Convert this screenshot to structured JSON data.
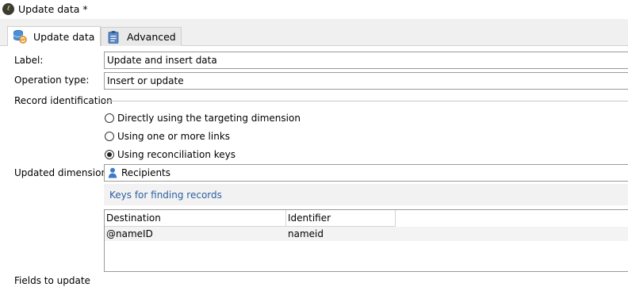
{
  "window": {
    "title": "Update data *",
    "logo_icon": "app-logo-icon"
  },
  "tabs": [
    {
      "label": "Update data",
      "icon": "database-sync-icon",
      "active": true
    },
    {
      "label": "Advanced",
      "icon": "clipboard-icon",
      "active": false
    }
  ],
  "form": {
    "label_caption": "Label:",
    "label_value": "Update and insert data",
    "operation_caption": "Operation type:",
    "operation_value": "Insert or update",
    "record_identification_caption": "Record identification",
    "radios": [
      {
        "label": "Directly using the targeting dimension",
        "checked": false
      },
      {
        "label": "Using one or more links",
        "checked": false
      },
      {
        "label": "Using reconciliation keys",
        "checked": true
      }
    ],
    "updated_dimension_caption": "Updated dimension:",
    "updated_dimension_value": "Recipients",
    "updated_dimension_icon": "person-icon",
    "keys_link": "Keys for finding records",
    "fields_caption_partial": "Fields to update"
  },
  "keys_table": {
    "columns": [
      "Destination",
      "Identifier"
    ],
    "rows": [
      [
        "@nameID",
        "nameid"
      ]
    ]
  },
  "colors": {
    "link": "#2c5fa0",
    "tab_strip_bg": "#f0f0f0",
    "keys_bar_bg": "#f2f2f2",
    "row_bg": "#f3f3f3"
  }
}
